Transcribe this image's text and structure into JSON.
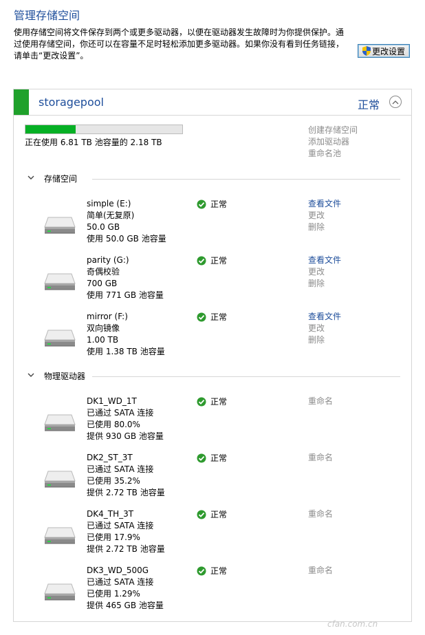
{
  "header": {
    "title": "管理存储空间",
    "desc_line1": "使用存储空间将文件保存到两个或更多驱动器，以便在驱动器发生故障时为你提供保护。通",
    "desc_line2": "过使用存储空间，你还可以在容量不足时轻松添加更多驱动器。如果你没有看到任务链接，",
    "desc_line3": "请单击“更改设置”。",
    "change_settings": "更改设置",
    "change_settings_icon": "uac-shield-icon"
  },
  "pool": {
    "name": "storagepool",
    "status": "正常",
    "collapse_icon": "chevron-up-icon",
    "accent_color": "#1fa12b",
    "usage_fraction": 0.32,
    "usage_text": "正在使用 6.81 TB 池容量的 2.18 TB",
    "actions": [
      "创建存储空间",
      "添加驱动器",
      "重命名池"
    ]
  },
  "spaces_section": {
    "label": "存储空间",
    "icon": "chevron-down-icon"
  },
  "spaces": [
    {
      "name": "simple (E:)",
      "type": "简单(无复原)",
      "size": "50.0 GB",
      "usage": "使用 50.0 GB 池容量",
      "status": "正常",
      "view": "查看文件",
      "change": "更改",
      "delete": "删除"
    },
    {
      "name": "parity (G:)",
      "type": "奇偶校验",
      "size": "700 GB",
      "usage": "使用 771 GB 池容量",
      "status": "正常",
      "view": "查看文件",
      "change": "更改",
      "delete": "删除"
    },
    {
      "name": "mirror (F:)",
      "type": "双向镜像",
      "size": "1.00 TB",
      "usage": "使用 1.38 TB 池容量",
      "status": "正常",
      "view": "查看文件",
      "change": "更改",
      "delete": "删除"
    }
  ],
  "drives_section": {
    "label": "物理驱动器",
    "icon": "chevron-down-icon"
  },
  "drives": [
    {
      "name": "DK1_WD_1T",
      "conn": "已通过 SATA 连接",
      "used": "已使用 80.0%",
      "provide": "提供 930 GB 池容量",
      "status": "正常",
      "rename": "重命名"
    },
    {
      "name": "DK2_ST_3T",
      "conn": "已通过 SATA 连接",
      "used": "已使用 35.2%",
      "provide": "提供 2.72 TB 池容量",
      "status": "正常",
      "rename": "重命名"
    },
    {
      "name": "DK4_TH_3T",
      "conn": "已通过 SATA 连接",
      "used": "已使用 17.9%",
      "provide": "提供 2.72 TB 池容量",
      "status": "正常",
      "rename": "重命名"
    },
    {
      "name": "DK3_WD_500G",
      "conn": "已通过 SATA 连接",
      "used": "已使用 1.29%",
      "provide": "提供 465 GB 池容量",
      "status": "正常",
      "rename": "重命名"
    }
  ],
  "watermark": "cfan.com.cn"
}
